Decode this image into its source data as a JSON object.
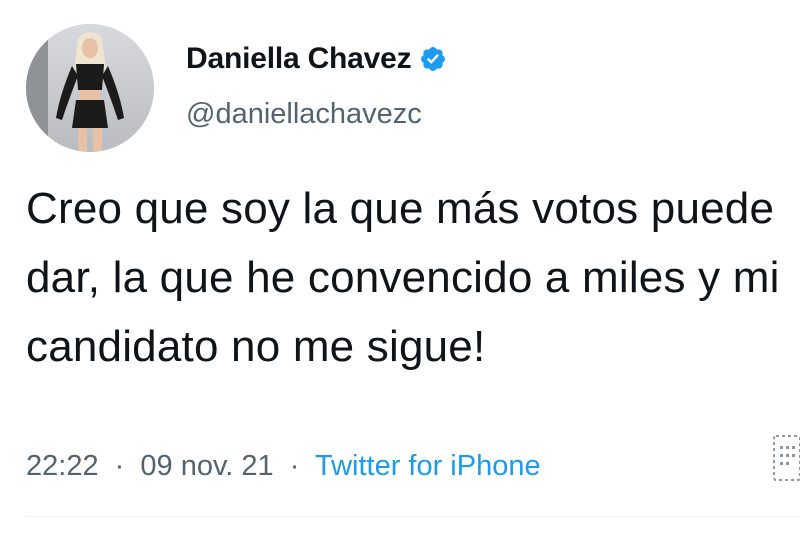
{
  "tweet": {
    "author": {
      "display_name": "Daniella Chavez",
      "handle": "@daniellachavezc",
      "verified": true,
      "avatar_icon": "profile-photo",
      "verified_icon": "verified-badge-icon"
    },
    "text": "Creo que soy la que más votos puede dar, la que he convencido a miles y mi candidato no me sigue!",
    "meta": {
      "time": "22:22",
      "date": "09 nov. 21",
      "separator": "·",
      "source": "Twitter for iPhone"
    },
    "colors": {
      "accent": "#1d9bf0",
      "secondary_text": "#536471",
      "primary_text": "#0f1419"
    }
  }
}
